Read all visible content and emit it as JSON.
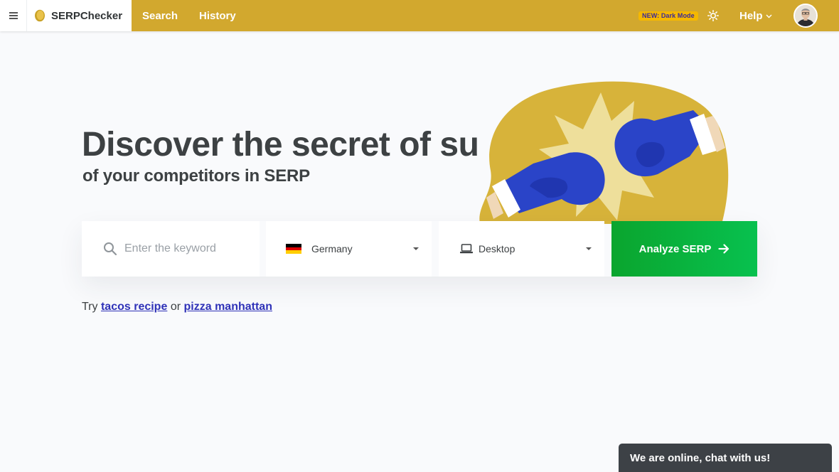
{
  "header": {
    "app_name": "SERPChecker",
    "nav": [
      {
        "label": "Search"
      },
      {
        "label": "History"
      }
    ],
    "badge": "NEW: Dark Mode",
    "help_label": "Help",
    "icons": {
      "menu": "menu-icon",
      "logo": "coin-logo-icon",
      "theme": "sun-icon",
      "help_caret": "chevron-down-icon"
    }
  },
  "hero": {
    "title": "Discover the secret of su",
    "subtitle": "of your competitors in SERP"
  },
  "search": {
    "keyword_placeholder": "Enter the keyword",
    "keyword_value": "",
    "country": "Germany",
    "device": "Desktop",
    "submit_label": "Analyze SERP"
  },
  "suggestions": {
    "prefix": "Try",
    "joiner": "or",
    "items": [
      "tacos recipe",
      "pizza manhattan"
    ]
  },
  "chat": {
    "label": "We are online, chat with us!"
  },
  "colors": {
    "header_bg": "#d2a82e",
    "badge_bg": "#f5b800",
    "button_green": "#0aa52e",
    "link": "#2f32b8",
    "glove_blue": "#2a44c8",
    "flag": [
      "#000000",
      "#dd0000",
      "#ffce00"
    ]
  }
}
